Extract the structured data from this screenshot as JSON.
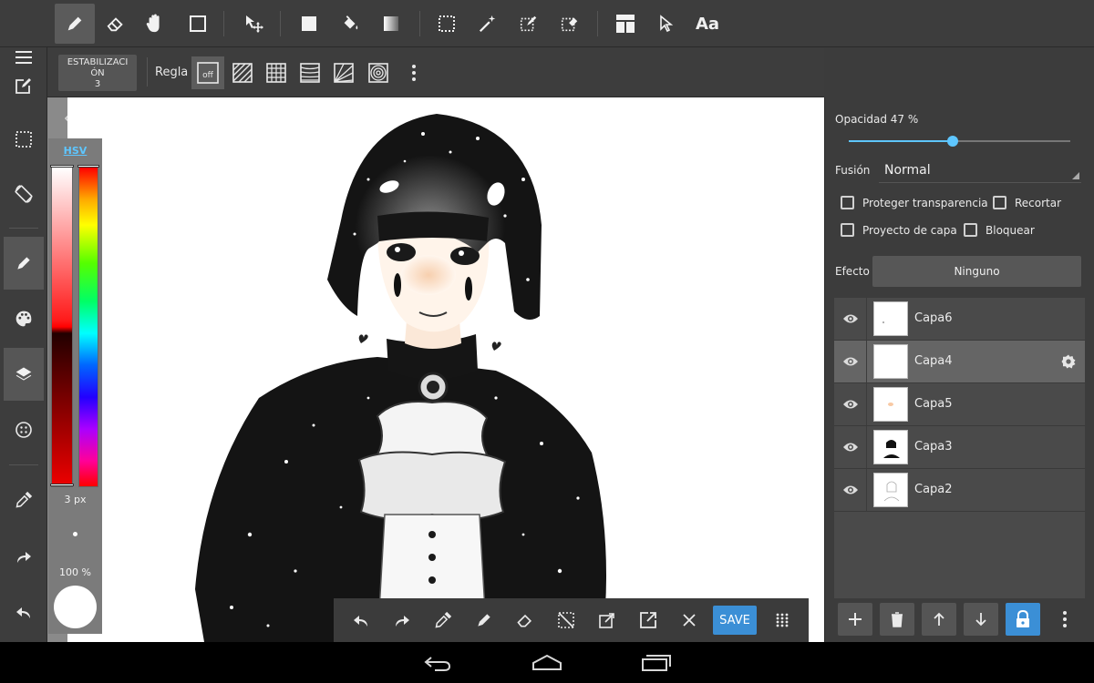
{
  "top_toolbar": {
    "tools": [
      {
        "id": "pen",
        "icon": "pen-icon",
        "active": true
      },
      {
        "id": "eraser",
        "icon": "eraser-icon"
      },
      {
        "id": "hand",
        "icon": "hand-icon"
      },
      {
        "id": "shape",
        "icon": "square-outline-icon"
      },
      {
        "id": "move",
        "icon": "move-icon"
      },
      {
        "id": "fill-rect",
        "icon": "filled-square-icon"
      },
      {
        "id": "bucket",
        "icon": "paint-bucket-icon"
      },
      {
        "id": "gradient",
        "icon": "gradient-icon"
      },
      {
        "id": "select-rect",
        "icon": "select-rect-icon"
      },
      {
        "id": "magic-wand",
        "icon": "magic-wand-icon"
      },
      {
        "id": "select-pen",
        "icon": "select-pen-icon"
      },
      {
        "id": "select-eraser",
        "icon": "select-eraser-icon"
      },
      {
        "id": "frame",
        "icon": "frame-divider-icon"
      },
      {
        "id": "pointer",
        "icon": "pointer-icon"
      }
    ],
    "text_tool_label": "Aa"
  },
  "sub_toolbar": {
    "stabilization_label": "ESTABILIZACI\nÓN\n3",
    "ruler_label": "Regla",
    "ruler_off_label": "off"
  },
  "color_panel": {
    "mode_label": "HSV",
    "brush_size": "3 px",
    "opacity": "100 %",
    "current_color": "#ffffff"
  },
  "bottom_bar": {
    "save_label": "SAVE"
  },
  "layer_panel": {
    "opacity_label": "Opacidad 47 %",
    "opacity_value": 0.47,
    "blend_label": "Fusión",
    "blend_value": "Normal",
    "protect_alpha_label": "Proteger transparencia",
    "clip_label": "Recortar",
    "project_label": "Proyecto de capa",
    "lock_label": "Bloquear",
    "effect_label": "Efecto",
    "effect_value": "Ninguno",
    "layers": [
      {
        "name": "Capa6",
        "selected": false
      },
      {
        "name": "Capa4",
        "selected": true
      },
      {
        "name": "Capa5",
        "selected": false
      },
      {
        "name": "Capa3",
        "selected": false
      },
      {
        "name": "Capa2",
        "selected": false
      }
    ]
  },
  "colors": {
    "accent": "#5ec6ff",
    "primary_button": "#3b8fd6",
    "toolbar_bg": "#3d3d3d"
  }
}
